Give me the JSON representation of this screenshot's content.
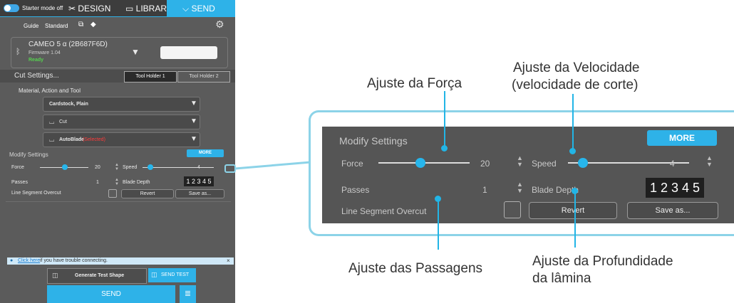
{
  "topbar": {
    "starter_mode": "Starter mode off",
    "design": "DESIGN",
    "library": "LIBRARY",
    "send": "SEND"
  },
  "subbar": {
    "guide": "Guide",
    "standard": "Standard"
  },
  "device": {
    "name": "CAMEO 5 α (2B687F6D)",
    "firmware": "Firmware 1.04",
    "status": "Ready",
    "status_color": "#56d14f"
  },
  "cut": {
    "title": "Cut Settings...",
    "tool_holder_1": "Tool Holder 1",
    "tool_holder_2": "Tool Holder 2",
    "section": "Material, Action and Tool",
    "material": "Cardstock, Plain",
    "action": "Cut",
    "tool": "AutoBlade",
    "tool_note": "(Selected)"
  },
  "modify": {
    "title": "Modify Settings",
    "more": "MORE",
    "force_label": "Force",
    "force_value": "20",
    "speed_label": "Speed",
    "speed_value": "4",
    "passes_label": "Passes",
    "passes_value": "1",
    "blade_label": "Blade Depth",
    "line_seg": "Line Segment Overcut",
    "revert": "Revert",
    "save_as": "Save as...",
    "blade_digits": "1 2 3 4 5"
  },
  "bottom": {
    "link": "Click here",
    "trouble": "if you have trouble connecting.",
    "gen_test": "Generate Test Shape",
    "send_test": "SEND TEST",
    "send": "SEND"
  },
  "callouts": {
    "force": "Ajuste da Força",
    "speed_line1": "Ajuste da Velocidade",
    "speed_line2": "(velocidade de corte)",
    "passes": "Ajuste das Passagens",
    "depth_line1": "Ajuste da Profundidade",
    "depth_line2": "da lâmina"
  },
  "colors": {
    "accent": "#2eb2e8",
    "panel": "#5b5b5b",
    "callout_line": "#22b5e6"
  }
}
